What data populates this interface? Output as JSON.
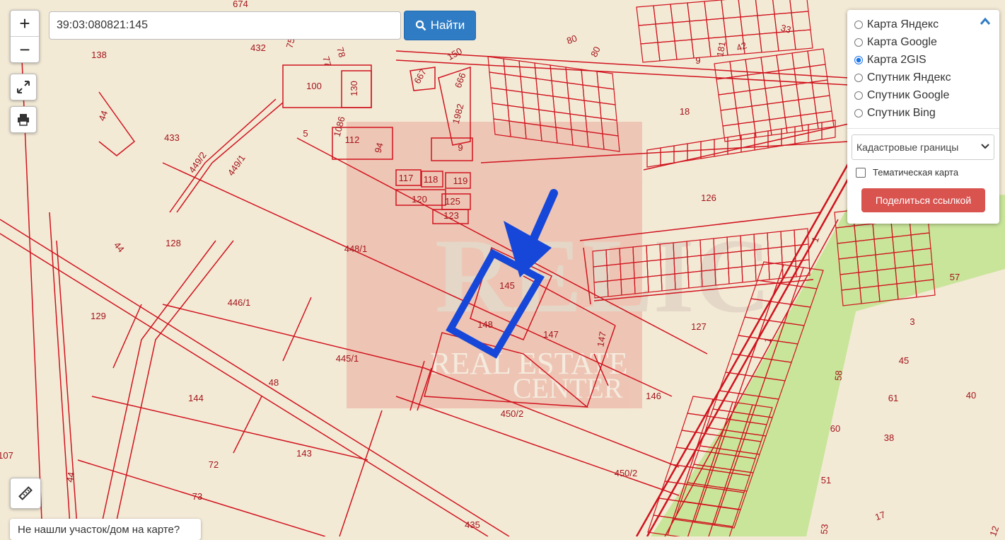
{
  "search": {
    "value": "39:03:080821:145",
    "button_label": "Найти"
  },
  "zoom": {
    "in": "+",
    "out": "−"
  },
  "layers": {
    "options": [
      "Карта Яндекс",
      "Карта Google",
      "Карта 2GIS",
      "Спутник Яндекс",
      "Спутник Google",
      "Спутник Bing"
    ],
    "selected": "Карта 2GIS",
    "overlay": "Кадастровые границы",
    "thematic_label": "Тематическая карта",
    "thematic_checked": false,
    "share_label": "Поделиться ссылкой"
  },
  "not_found_label": "Не нашли участок/дом на карте?",
  "watermark": {
    "line1": "REAL ESTATE",
    "line2": "CENTER"
  },
  "colors": {
    "boundary": "#d0131e",
    "label": "#a3151b",
    "highlight": "#1747d8",
    "button": "#2f7cc4",
    "share": "#d9534f",
    "green_zone": "#c9e59a",
    "background": "#f3ead6"
  },
  "parcel_labels": [
    "674",
    "432",
    "75",
    "78",
    "77",
    "100",
    "130",
    "138",
    "44",
    "433",
    "449/2",
    "449/1",
    "5",
    "1086",
    "112",
    "94",
    "667",
    "150",
    "666",
    "1982",
    "9",
    "117",
    "118",
    "119",
    "120",
    "125",
    "123",
    "80",
    "80",
    "33",
    "9",
    "181",
    "42",
    "18",
    "126",
    "128",
    "44",
    "448/1",
    "446/1",
    "129",
    "145",
    "148",
    "147",
    "147",
    "127",
    "445/1",
    "48",
    "144",
    "146",
    "450/2",
    "143",
    "72",
    "73",
    "450/2",
    "435",
    "107",
    "44",
    "1",
    "1",
    "57",
    "3",
    "45",
    "58",
    "40",
    "61",
    "60",
    "38",
    "51",
    "53",
    "17",
    "12"
  ]
}
